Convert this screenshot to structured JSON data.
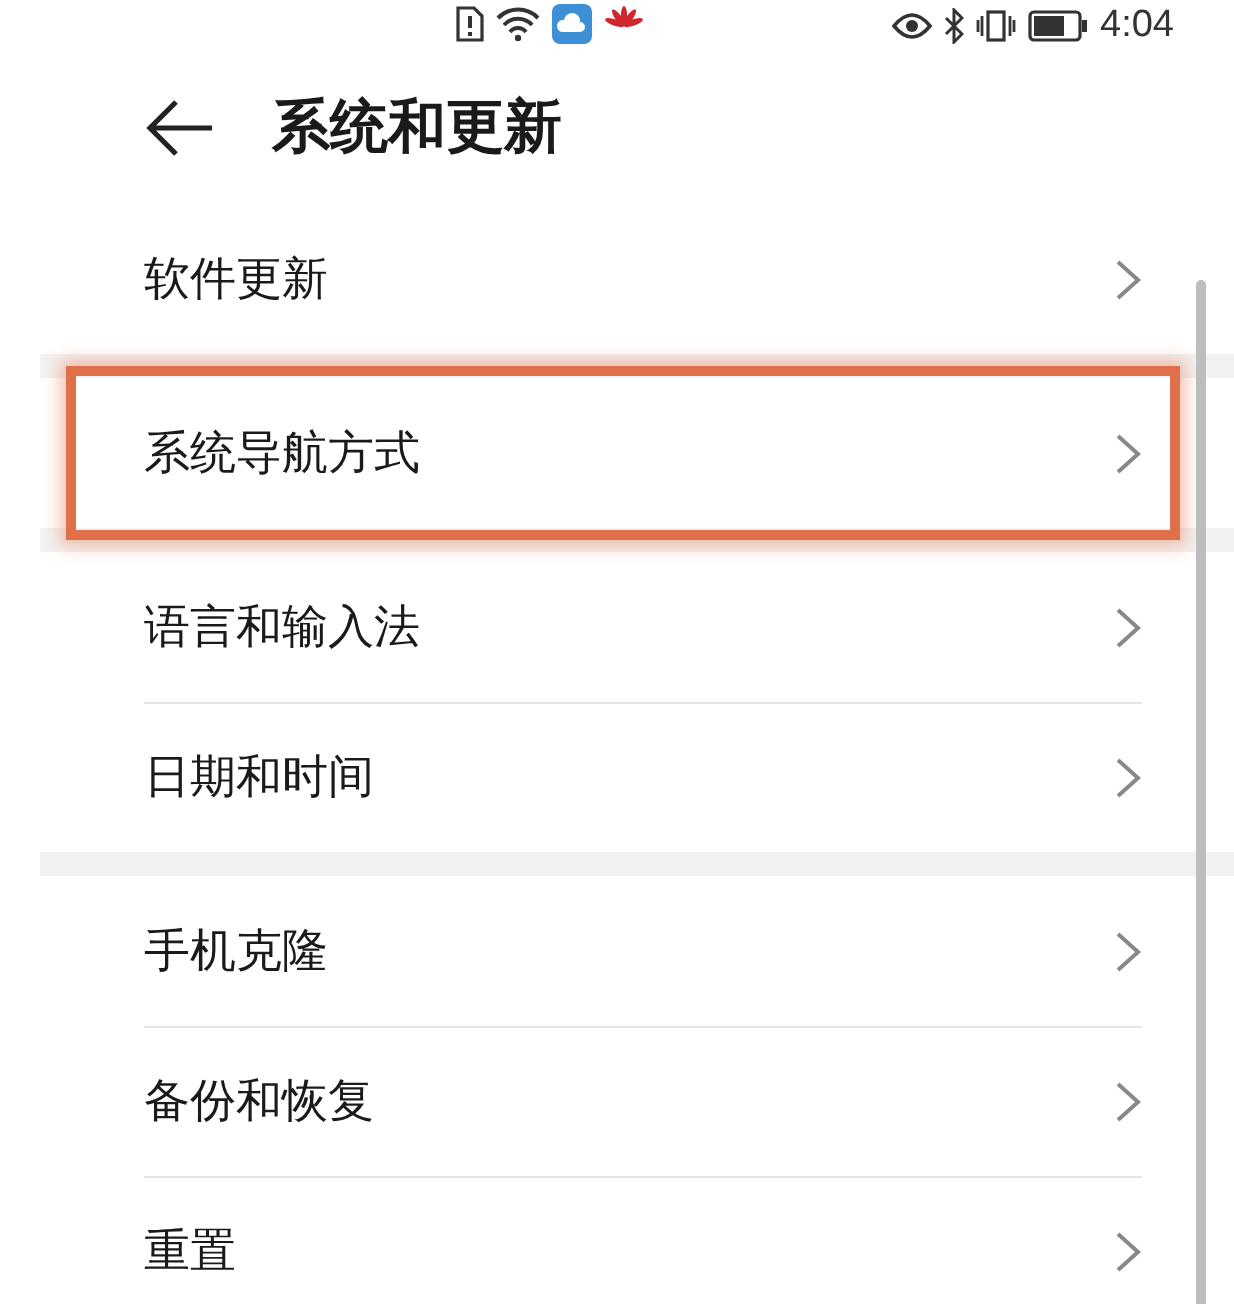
{
  "status_bar": {
    "time": "4:04"
  },
  "header": {
    "title": "系统和更新"
  },
  "groups": [
    {
      "items": [
        {
          "label": "软件更新",
          "highlighted": false
        }
      ]
    },
    {
      "items": [
        {
          "label": "系统导航方式",
          "highlighted": true
        }
      ]
    },
    {
      "items": [
        {
          "label": "语言和输入法",
          "highlighted": false
        },
        {
          "label": "日期和时间",
          "highlighted": false
        }
      ]
    },
    {
      "items": [
        {
          "label": "手机克隆",
          "highlighted": false
        },
        {
          "label": "备份和恢复",
          "highlighted": false
        },
        {
          "label": "重置",
          "highlighted": false
        }
      ]
    }
  ]
}
